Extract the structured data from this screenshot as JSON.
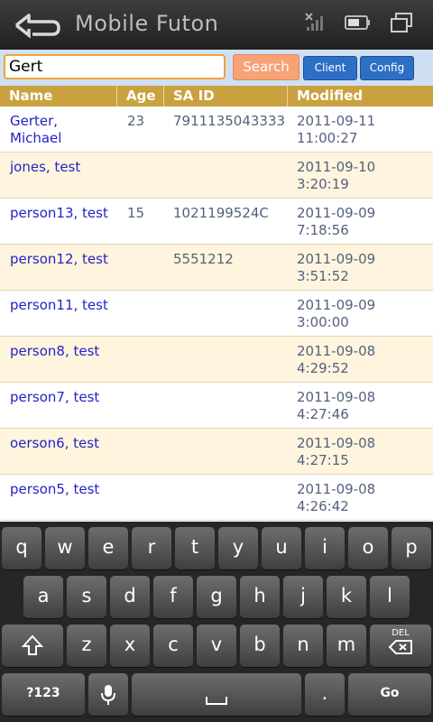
{
  "app": {
    "title": "Mobile Futon"
  },
  "search": {
    "value": "Gert",
    "button": "Search",
    "client": "Client",
    "config": "Config"
  },
  "table": {
    "headers": [
      "Name",
      "Age",
      "SA ID",
      "Modified"
    ],
    "rows": [
      {
        "name": "Gerter, Michael",
        "age": "23",
        "said": "7911135043333",
        "date": "2011-09-11",
        "time": "11:00:27"
      },
      {
        "name": "jones, test",
        "age": "",
        "said": "",
        "date": "2011-09-10",
        "time": "3:20:19"
      },
      {
        "name": "person13, test",
        "age": "15",
        "said": "1021199524C",
        "date": "2011-09-09",
        "time": "7:18:56"
      },
      {
        "name": "person12, test",
        "age": "",
        "said": "5551212",
        "date": "2011-09-09",
        "time": "3:51:52"
      },
      {
        "name": "person11, test",
        "age": "",
        "said": "",
        "date": "2011-09-09",
        "time": "3:00:00"
      },
      {
        "name": "person8, test",
        "age": "",
        "said": "",
        "date": "2011-09-08",
        "time": "4:29:52"
      },
      {
        "name": "person7, test",
        "age": "",
        "said": "",
        "date": "2011-09-08",
        "time": "4:27:46"
      },
      {
        "name": "oerson6, test",
        "age": "",
        "said": "",
        "date": "2011-09-08",
        "time": "4:27:15"
      },
      {
        "name": "person5, test",
        "age": "",
        "said": "",
        "date": "2011-09-08",
        "time": "4:26:42"
      }
    ]
  },
  "keyboard": {
    "row1": [
      "q",
      "w",
      "e",
      "r",
      "t",
      "y",
      "u",
      "i",
      "o",
      "p"
    ],
    "row2": [
      "a",
      "s",
      "d",
      "f",
      "g",
      "h",
      "j",
      "k",
      "l"
    ],
    "row3": [
      "z",
      "x",
      "c",
      "v",
      "b",
      "n",
      "m"
    ],
    "delete_label": "DEL",
    "symbols": "?123",
    "period": ".",
    "go": "Go"
  },
  "icons": {
    "back": "back-arrow-icon",
    "signal": "no-signal-icon",
    "battery": "battery-icon",
    "windows": "windows-icon",
    "shift": "shift-icon",
    "mic": "microphone-icon",
    "space": "space-icon"
  }
}
